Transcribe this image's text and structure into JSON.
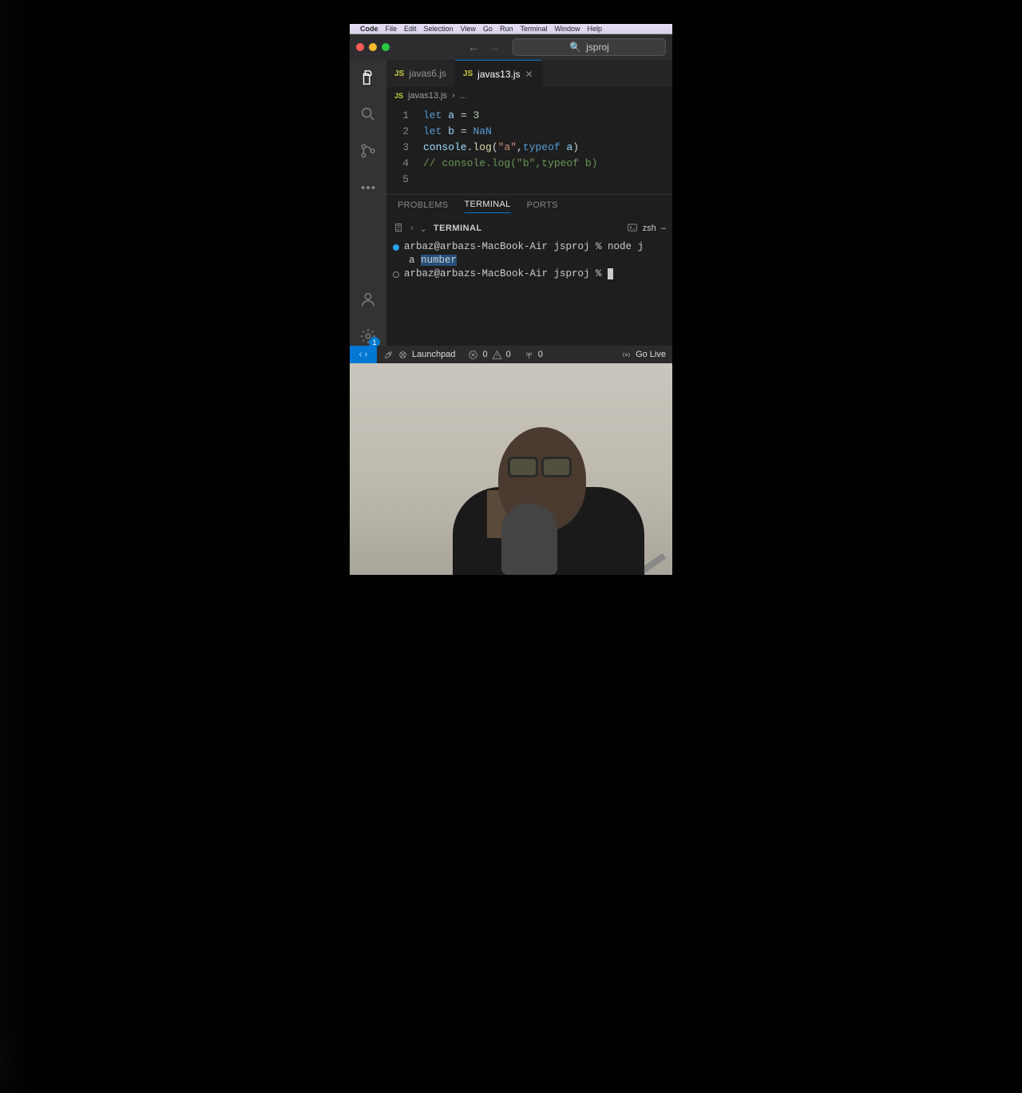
{
  "mac_menu": {
    "app": "Code",
    "items": [
      "File",
      "Edit",
      "Selection",
      "View",
      "Go",
      "Run",
      "Terminal",
      "Window",
      "Help"
    ]
  },
  "search": {
    "text": "jsproj"
  },
  "tabs": [
    {
      "icon": "JS",
      "label": "javas6.js",
      "active": false
    },
    {
      "icon": "JS",
      "label": "javas13.js",
      "active": true
    }
  ],
  "breadcrumb": {
    "icon": "JS",
    "file": "javas13.js",
    "sep": "›",
    "rest": "..."
  },
  "code_lines": [
    {
      "n": "1",
      "tokens": [
        [
          "kw",
          "let "
        ],
        [
          "var",
          "a"
        ],
        [
          "pl",
          " = "
        ],
        [
          "num",
          "3"
        ]
      ]
    },
    {
      "n": "2",
      "tokens": [
        [
          "kw",
          "let "
        ],
        [
          "var",
          "b"
        ],
        [
          "pl",
          " = "
        ],
        [
          "nan",
          "NaN"
        ]
      ]
    },
    {
      "n": "3",
      "tokens": [
        [
          "obj",
          "console"
        ],
        [
          "pl",
          "."
        ],
        [
          "fn",
          "log"
        ],
        [
          "pl",
          "("
        ],
        [
          "str",
          "\"a\""
        ],
        [
          "pl",
          ","
        ],
        [
          "op",
          "typeof "
        ],
        [
          "var",
          "a"
        ],
        [
          "pl",
          ")"
        ]
      ]
    },
    {
      "n": "4",
      "tokens": [
        [
          "cm",
          "// console.log(\"b\",typeof b)"
        ]
      ]
    },
    {
      "n": "5",
      "tokens": []
    }
  ],
  "panel_tabs": [
    "PROBLEMS",
    "TERMINAL",
    "PORTS"
  ],
  "panel_active": "TERMINAL",
  "terminal": {
    "title": "TERMINAL",
    "shell": "zsh",
    "lines": [
      {
        "dot": "blue",
        "text": "arbaz@arbazs-MacBook-Air jsproj % node j"
      },
      {
        "dot": "",
        "indent": true,
        "text_a": "a ",
        "text_hl": "number"
      },
      {
        "dot": "gray",
        "text": "arbaz@arbazs-MacBook-Air jsproj % ",
        "cursor": true
      }
    ]
  },
  "status": {
    "launchpad": "Launchpad",
    "errors": "0",
    "warnings": "0",
    "ports_icon_val": "0",
    "golive": "Go Live"
  },
  "settings_badge": "1"
}
